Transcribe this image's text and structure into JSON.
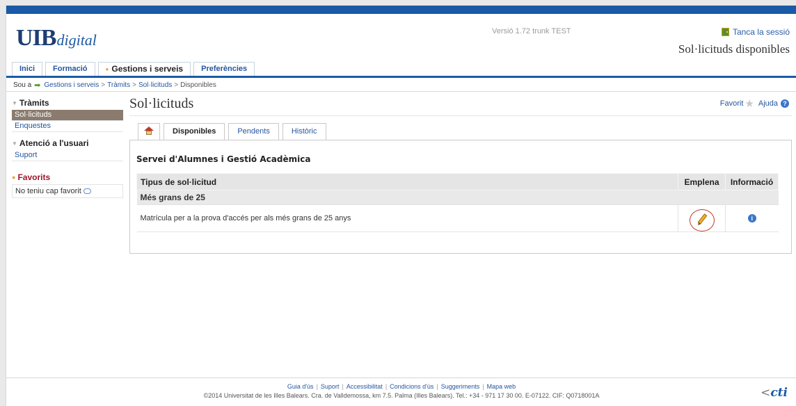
{
  "header": {
    "logo_main": "UIB",
    "logo_sub": "digital",
    "version": "Versió 1.72 trunk TEST",
    "logout": "Tanca la sessió",
    "heading": "Sol·licituds disponibles"
  },
  "nav": {
    "tabs": [
      {
        "label": "Inici"
      },
      {
        "label": "Formació"
      },
      {
        "label": "Gestions i serveis",
        "active": true
      },
      {
        "label": "Preferències"
      }
    ]
  },
  "breadcrumb": {
    "lead": "Sou a",
    "items": [
      "Gestions i serveis",
      "Tràmits",
      "Sol·licituds",
      "Disponibles"
    ]
  },
  "sidebar": {
    "sections": [
      {
        "title": "Tràmits",
        "items": [
          "Sol·licituds",
          "Enquestes"
        ]
      },
      {
        "title": "Atenció a l'usuari",
        "items": [
          "Suport"
        ]
      }
    ],
    "favorites_title": "Favorits",
    "favorites_empty": "No teniu cap favorit"
  },
  "main": {
    "title": "Sol·licituds",
    "favorite": "Favorit",
    "help": "Ajuda",
    "tabs": [
      "Disponibles",
      "Pendents",
      "Històric"
    ],
    "service": "Servei d'Alumnes i Gestió Acadèmica",
    "table": {
      "headers": [
        "Tipus de sol·licitud",
        "Emplena",
        "Informació"
      ],
      "group": "Més grans de 25",
      "rows": [
        {
          "type": "Matrícula per a la prova d'accés per als més grans de 25 anys"
        }
      ]
    }
  },
  "footer": {
    "links": [
      "Guia d'ús",
      "Suport",
      "Accessibilitat",
      "Condicions d'ús",
      "Suggeriments",
      "Mapa web"
    ],
    "legal": "©2014 Universitat de les Illes Balears. Cra. de Valldemossa, km 7.5. Palma (Illes Balears). Tel.: +34 - 971 17 30 00. E-07122. CIF: Q0718001A",
    "brand": "cti"
  },
  "colors": {
    "primary": "#1a5aa6",
    "selected": "#8a7b6e",
    "favorites": "#a0152a",
    "accent": "#f0a030"
  }
}
